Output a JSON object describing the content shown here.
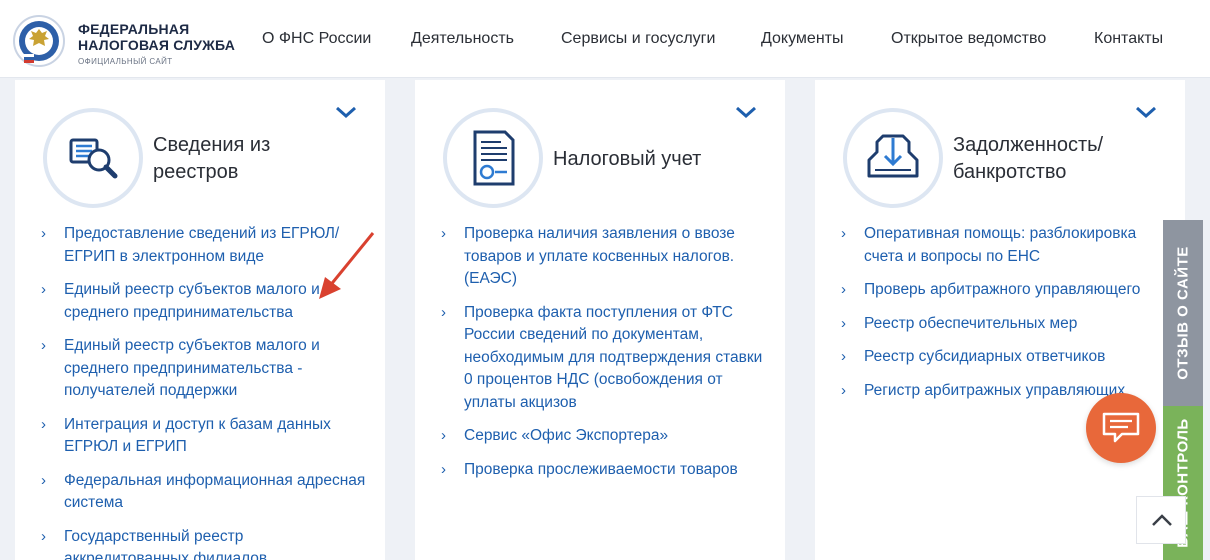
{
  "header": {
    "brand_line1": "ФЕДЕРАЛЬНАЯ",
    "brand_line2": "НАЛОГОВАЯ СЛУЖБА",
    "brand_line3": "ОФИЦИАЛЬНЫЙ САЙТ",
    "nav": [
      "О ФНС России",
      "Деятельность",
      "Сервисы и госуслуги",
      "Документы",
      "Открытое ведомство",
      "Контакты"
    ]
  },
  "cards": [
    {
      "title_line1": "Сведения из",
      "title_line2": "реестров",
      "icon": "registry-search-icon",
      "links": [
        "Предоставление сведений из ЕГРЮЛ/ЕГРИП в электронном виде",
        "Единый реестр субъектов малого и среднего предпринимательства",
        "Единый реестр субъектов малого и среднего предпринимательства - получателей поддержки",
        "Интеграция и доступ к базам данных ЕГРЮЛ и ЕГРИП",
        "Федеральная информационная адресная система",
        "Государственный реестр аккредитованных филиалов"
      ]
    },
    {
      "title_line1": "Налоговый учет",
      "title_line2": "",
      "icon": "tax-document-icon",
      "links": [
        "Проверка наличия заявления о ввозе товаров и уплате косвенных налогов. (ЕАЭС)",
        "Проверка факта поступления от ФТС России сведений по документам, необходимым для подтверждения ставки 0 процентов НДС (освобождения от уплаты акцизов",
        "Сервис «Офис Экспортера»",
        "Проверка прослеживаемости товаров"
      ]
    },
    {
      "title_line1": "Задолженность/",
      "title_line2": "банкротство",
      "icon": "debt-bankruptcy-icon",
      "links": [
        "Оперативная помощь: разблокировка счета и вопросы по ЕНС",
        "Проверь арбитражного управляющего",
        "Реестр обеспечительных мер",
        "Реестр субсидиарных ответчиков",
        "Регистр арбитражных управляющих"
      ]
    }
  ],
  "side": {
    "feedback_label": "ОТЗЫВ О САЙТЕ",
    "control_label": "ВАШ КОНТРОЛЬ"
  },
  "colors": {
    "link": "#1e5fae",
    "brand_dark": "#1d2a45",
    "chat_button": "#e8683a",
    "feedback_tab": "#8e95a0",
    "control_tab": "#7ab35a",
    "annotation_arrow": "#d9412f"
  }
}
